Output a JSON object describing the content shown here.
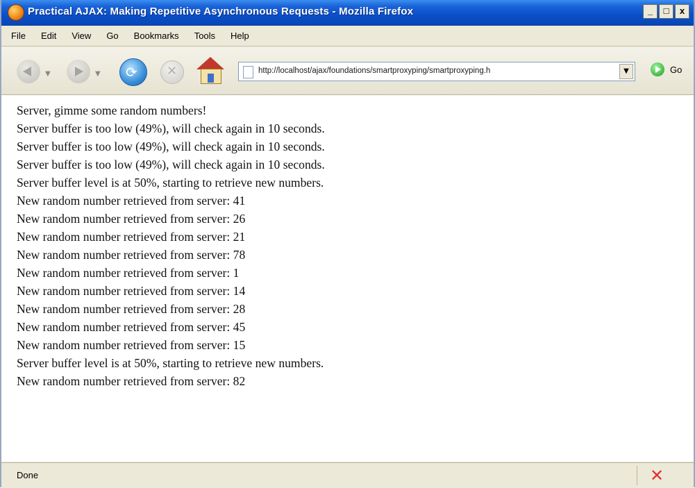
{
  "window": {
    "title": "Practical AJAX: Making Repetitive Asynchronous Requests - Mozilla Firefox",
    "controls": {
      "minimize": "_",
      "maximize": "□",
      "close": "x"
    }
  },
  "menubar": {
    "items": [
      {
        "label": "File"
      },
      {
        "label": "Edit"
      },
      {
        "label": "View"
      },
      {
        "label": "Go"
      },
      {
        "label": "Bookmarks"
      },
      {
        "label": "Tools"
      },
      {
        "label": "Help"
      }
    ]
  },
  "toolbar": {
    "url": "http://localhost/ajax/foundations/smartproxyping/smartproxyping.h",
    "go_label": "Go",
    "icons": [
      "back-arrow-icon",
      "forward-arrow-icon",
      "reload-icon",
      "stop-icon",
      "home-icon",
      "page-icon",
      "go-icon"
    ]
  },
  "content": {
    "lines": [
      "Server, gimme some random numbers!",
      "Server buffer is too low (49%), will check again in 10 seconds.",
      "Server buffer is too low (49%), will check again in 10 seconds.",
      "Server buffer is too low (49%), will check again in 10 seconds.",
      "Server buffer level is at 50%, starting to retrieve new numbers.",
      "New random number retrieved from server: 41",
      "New random number retrieved from server: 26",
      "New random number retrieved from server: 21",
      "New random number retrieved from server: 78",
      "New random number retrieved from server: 1",
      "New random number retrieved from server: 14",
      "New random number retrieved from server: 28",
      "New random number retrieved from server: 45",
      "New random number retrieved from server: 15",
      "Server buffer level is at 50%, starting to retrieve new numbers.",
      "New random number retrieved from server: 82"
    ]
  },
  "status": {
    "text": "Done",
    "icon": "error-x-icon",
    "icon_color": "#e03030"
  },
  "colors": {
    "titlebar": "#0b4fc8",
    "chrome": "#ece9d8",
    "content_bg": "#ffffff"
  }
}
